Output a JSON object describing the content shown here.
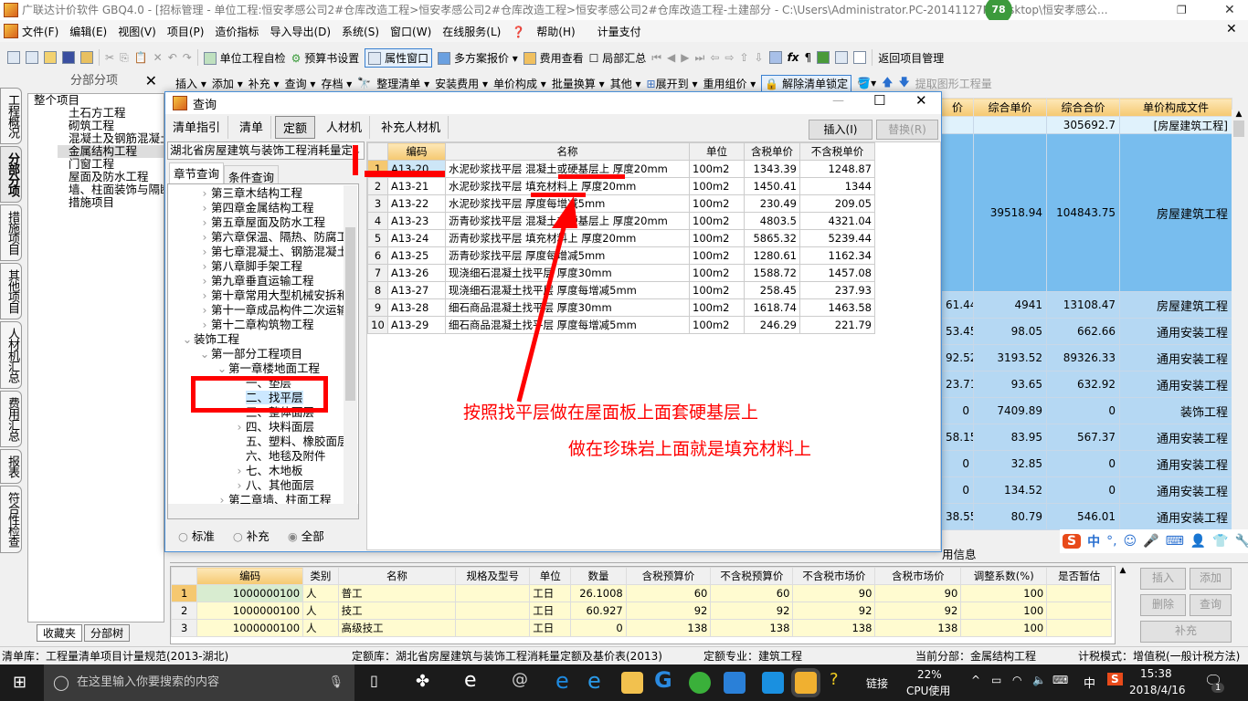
{
  "window": {
    "title": "广联达计价软件 GBQ4.0 - [招标管理 - 单位工程:恒安孝感公司2#仓库改造工程>恒安孝感公司2#仓库改造工程>恒安孝感公司2#仓库改造工程-土建部分 - C:\\Users\\Administrator.PC-20141127NR  esktop\\恒安孝感公...",
    "badge": "78"
  },
  "menu": [
    "文件(F)",
    "编辑(E)",
    "视图(V)",
    "项目(P)",
    "造价指标",
    "导入导出(D)",
    "系统(S)",
    "窗口(W)",
    "在线服务(L)",
    "帮助(H)",
    "计量支付"
  ],
  "toolbar": {
    "self_check": "单位工程自检",
    "budget_setting": "预算书设置",
    "property_window": "属性窗口",
    "multi_quote": "多方案报价",
    "fee_view": "费用查看",
    "partial_sum": "局部汇总",
    "return_mgmt": "返回项目管理"
  },
  "toolbar2": {
    "insert": "插入",
    "add": "添加",
    "supplement": "补充",
    "query": "查询",
    "archive": "存档",
    "organize": "整理清单",
    "install_fee": "安装费用",
    "unit_price": "单价构成",
    "batch": "批量换算",
    "other": "其他",
    "expand": "展开到",
    "reuse": "重用组价",
    "unlock": "解除清单锁定",
    "extract": "提取图形工程量"
  },
  "left_tabs": [
    "工程概况",
    "分部分项",
    "措施项目",
    "其他项目",
    "人材机汇总",
    "费用汇总",
    "报表",
    "符合性检查"
  ],
  "left_panel": {
    "title": "分部分项",
    "root": "整个项目",
    "items": [
      "土石方工程",
      "砌筑工程",
      "混凝土及钢筋混凝土工程",
      "金属结构工程",
      "门窗工程",
      "屋面及防水工程",
      "墙、柱面装饰与隔断、幕",
      "措施项目"
    ],
    "selected": "金属结构工程",
    "bottom_tabs": [
      "收藏夹",
      "分部树"
    ]
  },
  "main_grid": {
    "headers": [
      "价",
      "综合单价",
      "综合合价",
      "单价构成文件"
    ],
    "top_row": [
      "",
      "",
      "305692.7",
      "[房屋建筑工程]"
    ],
    "rows": [
      [
        "",
        "39518.94",
        "104843.75",
        "房屋建筑工程"
      ],
      [
        "61.44",
        "4941",
        "13108.47",
        "房屋建筑工程"
      ],
      [
        "53.45",
        "98.05",
        "662.66",
        "通用安装工程"
      ],
      [
        "92.52",
        "3193.52",
        "89326.33",
        "通用安装工程"
      ],
      [
        "23.71",
        "93.65",
        "632.92",
        "通用安装工程"
      ],
      [
        "0",
        "7409.89",
        "0",
        "装饰工程"
      ],
      [
        "58.15",
        "83.95",
        "567.37",
        "通用安装工程"
      ],
      [
        "0",
        "32.85",
        "0",
        "通用安装工程"
      ],
      [
        "0",
        "134.52",
        "0",
        "通用安装工程"
      ],
      [
        "38.55",
        "80.79",
        "546.01",
        "通用安装工程"
      ]
    ]
  },
  "dialog": {
    "title": "查询",
    "tabs": [
      "清单指引",
      "清单",
      "定额",
      "人材机",
      "补充人材机"
    ],
    "active_tab": "定额",
    "insert_btn": "插入(I)",
    "replace_btn": "替换(R)",
    "library": "湖北省房屋建筑与装饰工程消耗量定",
    "subtabs": [
      "章节查询",
      "条件查询"
    ],
    "tree": [
      [
        "第三章木结构工程",
        1,
        ">"
      ],
      [
        "第四章金属结构工程",
        1,
        ">"
      ],
      [
        "第五章屋面及防水工程",
        1,
        ">"
      ],
      [
        "第六章保温、隔热、防腐工",
        1,
        ">"
      ],
      [
        "第七章混凝土、钢筋混凝土",
        1,
        ">"
      ],
      [
        "第八章脚手架工程",
        1,
        ">"
      ],
      [
        "第九章垂直运输工程",
        1,
        ">"
      ],
      [
        "第十章常用大型机械安拆和",
        1,
        ">"
      ],
      [
        "第十一章成品构件二次运输",
        1,
        ">"
      ],
      [
        "第十二章构筑物工程",
        1,
        ">"
      ],
      [
        "装饰工程",
        0,
        "v"
      ],
      [
        "第一部分工程项目",
        1,
        "v"
      ],
      [
        "第一章楼地面工程",
        2,
        "v"
      ],
      [
        "一、垫层",
        3,
        ""
      ],
      [
        "二、找平层",
        3,
        ""
      ],
      [
        "三、整体面层",
        3,
        ""
      ],
      [
        "四、块料面层",
        3,
        ">"
      ],
      [
        "五、塑料、橡胶面层",
        3,
        ""
      ],
      [
        "六、地毯及附件",
        3,
        ""
      ],
      [
        "七、木地板",
        3,
        ">"
      ],
      [
        "八、其他面层",
        3,
        ">"
      ],
      [
        "第二章墙、柱面工程",
        2,
        ">"
      ]
    ],
    "radios": [
      "标准",
      "补充",
      "全部"
    ],
    "radio_selected": "全部",
    "table_headers": [
      "编码",
      "名称",
      "单位",
      "含税单价",
      "不含税单价"
    ],
    "rows": [
      [
        "A13-20",
        "水泥砂浆找平层 混凝土或硬基层上 厚度20mm",
        "100m2",
        "1343.39",
        "1248.87"
      ],
      [
        "A13-21",
        "水泥砂浆找平层 填充材料上 厚度20mm",
        "100m2",
        "1450.41",
        "1344"
      ],
      [
        "A13-22",
        "水泥砂浆找平层 厚度每增减5mm",
        "100m2",
        "230.49",
        "209.05"
      ],
      [
        "A13-23",
        "沥青砂浆找平层 混凝土或硬基层上 厚度20mm",
        "100m2",
        "4803.5",
        "4321.04"
      ],
      [
        "A13-24",
        "沥青砂浆找平层 填充材料上 厚度20mm",
        "100m2",
        "5865.32",
        "5239.44"
      ],
      [
        "A13-25",
        "沥青砂浆找平层 厚度每增减5mm",
        "100m2",
        "1280.61",
        "1162.34"
      ],
      [
        "A13-26",
        "现浇细石混凝土找平层 厚度30mm",
        "100m2",
        "1588.72",
        "1457.08"
      ],
      [
        "A13-27",
        "现浇细石混凝土找平层 厚度每增减5mm",
        "100m2",
        "258.45",
        "237.93"
      ],
      [
        "A13-28",
        "细石商品混凝土找平层 厚度30mm",
        "100m2",
        "1618.74",
        "1463.58"
      ],
      [
        "A13-29",
        "细石商品混凝土找平层 厚度每增减5mm",
        "100m2",
        "246.29",
        "221.79"
      ]
    ]
  },
  "annotation": {
    "line1": "按照找平层做在屋面板上面套硬基层上",
    "line2": "做在珍珠岩上面就是填充材料上",
    "color": "#ff0000"
  },
  "bottom": {
    "tab_partial": "用信息",
    "headers": [
      "编码",
      "类别",
      "名称",
      "规格及型号",
      "单位",
      "数量",
      "含税预算价",
      "不含税预算价",
      "不含税市场价",
      "含税市场价",
      "调整系数(%)",
      "是否暂估"
    ],
    "rows": [
      [
        "1000000100",
        "人",
        "普工",
        "",
        "工日",
        "26.1008",
        "60",
        "60",
        "90",
        "90",
        "100",
        ""
      ],
      [
        "1000000100",
        "人",
        "技工",
        "",
        "工日",
        "60.927",
        "92",
        "92",
        "92",
        "92",
        "100",
        ""
      ],
      [
        "1000000100",
        "人",
        "高级技工",
        "",
        "工日",
        "0",
        "138",
        "138",
        "138",
        "138",
        "100",
        ""
      ]
    ],
    "buttons": [
      "插入",
      "添加",
      "删除",
      "查询",
      "补充"
    ]
  },
  "status": {
    "bill_lib": "清单库：工程量清单项目计量规范(2013-湖北)",
    "quota_lib": "定额库：湖北省房屋建筑与装饰工程消耗量定额及基价表(2013)",
    "quota_major": "定额专业：建筑工程",
    "current_part": "当前分部：金属结构工程",
    "tax_mode": "计税模式：增值税(一般计税方法)"
  },
  "ime": {
    "lang": "中",
    "punct": "°,"
  },
  "taskbar": {
    "search": "在这里输入你要搜索的内容",
    "link": "链接",
    "cpu": "22%",
    "cpu_label": "CPU使用",
    "lang": "中",
    "time": "15:38",
    "date": "2018/4/16",
    "notif": "1"
  }
}
